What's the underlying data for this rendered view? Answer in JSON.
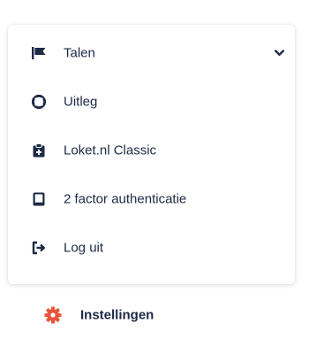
{
  "menu": {
    "items": [
      {
        "label": "Talen",
        "icon": "flag-icon",
        "has_chevron": true
      },
      {
        "label": "Uitleg",
        "icon": "lifebuoy-icon"
      },
      {
        "label": "Loket.nl Classic",
        "icon": "clipboard-icon"
      },
      {
        "label": "2 factor authenticatie",
        "icon": "tablet-icon"
      },
      {
        "label": "Log uit",
        "icon": "sign-out-icon"
      }
    ]
  },
  "settings": {
    "label": "Instellingen",
    "icon": "gear-icon"
  },
  "colors": {
    "text": "#1d2a45",
    "icon": "#1d2a45",
    "accent": "#e8553a",
    "background": "#ffffff"
  }
}
